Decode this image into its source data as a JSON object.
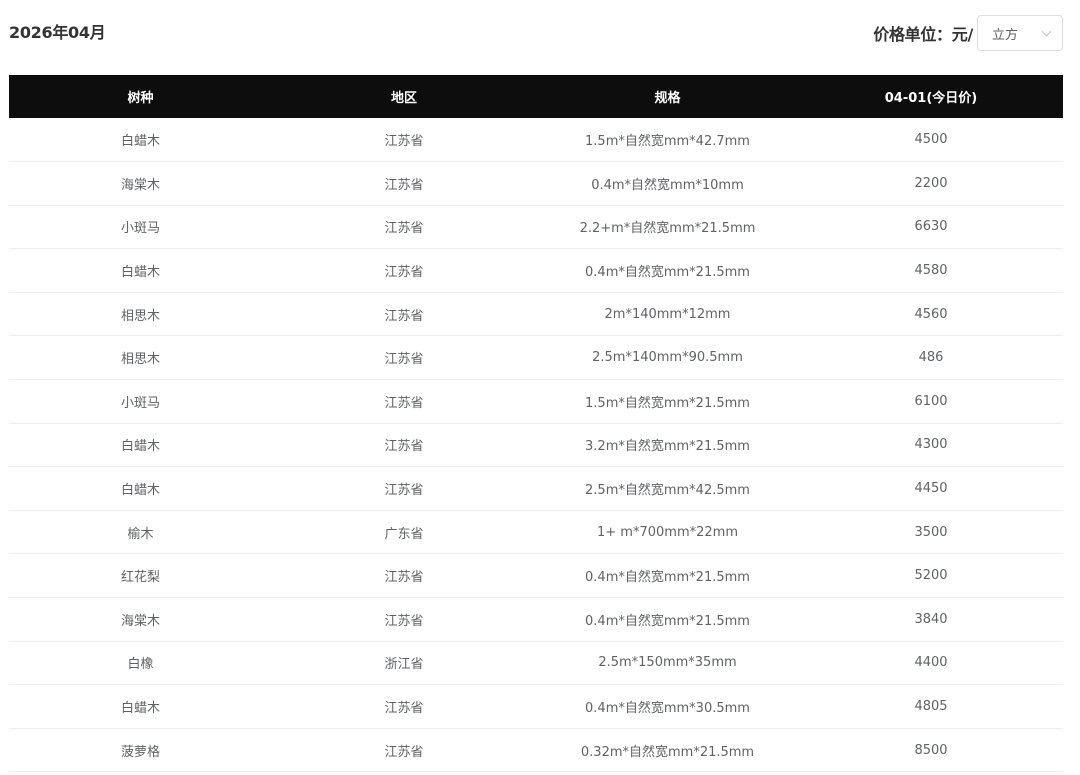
{
  "header": {
    "month_title": "2026年04月",
    "unit_label": "价格单位：元/",
    "unit_select_value": "立方"
  },
  "table": {
    "columns": [
      "树种",
      "地区",
      "规格",
      "04-01(今日价)"
    ],
    "rows": [
      [
        "白蜡木",
        "江苏省",
        "1.5m*自然宽mm*42.7mm",
        "4500"
      ],
      [
        "海棠木",
        "江苏省",
        "0.4m*自然宽mm*10mm",
        "2200"
      ],
      [
        "小斑马",
        "江苏省",
        "2.2+m*自然宽mm*21.5mm",
        "6630"
      ],
      [
        "白蜡木",
        "江苏省",
        "0.4m*自然宽mm*21.5mm",
        "4580"
      ],
      [
        "相思木",
        "江苏省",
        "2m*140mm*12mm",
        "4560"
      ],
      [
        "相思木",
        "江苏省",
        "2.5m*140mm*90.5mm",
        "486"
      ],
      [
        "小斑马",
        "江苏省",
        "1.5m*自然宽mm*21.5mm",
        "6100"
      ],
      [
        "白蜡木",
        "江苏省",
        "3.2m*自然宽mm*21.5mm",
        "4300"
      ],
      [
        "白蜡木",
        "江苏省",
        "2.5m*自然宽mm*42.5mm",
        "4450"
      ],
      [
        "榆木",
        "广东省",
        "1+ m*700mm*22mm",
        "3500"
      ],
      [
        "红花梨",
        "江苏省",
        "0.4m*自然宽mm*21.5mm",
        "5200"
      ],
      [
        "海棠木",
        "江苏省",
        "0.4m*自然宽mm*21.5mm",
        "3840"
      ],
      [
        "白橡",
        "浙江省",
        "2.5m*150mm*35mm",
        "4400"
      ],
      [
        "白蜡木",
        "江苏省",
        "0.4m*自然宽mm*30.5mm",
        "4805"
      ],
      [
        "菠萝格",
        "江苏省",
        "0.32m*自然宽mm*21.5mm",
        "8500"
      ]
    ]
  },
  "colors": {
    "header_bg": "#0d0d0d",
    "header_text": "#ffffff",
    "cell_text": "#606266",
    "row_divider": "#ebeef5"
  },
  "icons": {
    "select_arrow": "chevron-down-icon"
  }
}
